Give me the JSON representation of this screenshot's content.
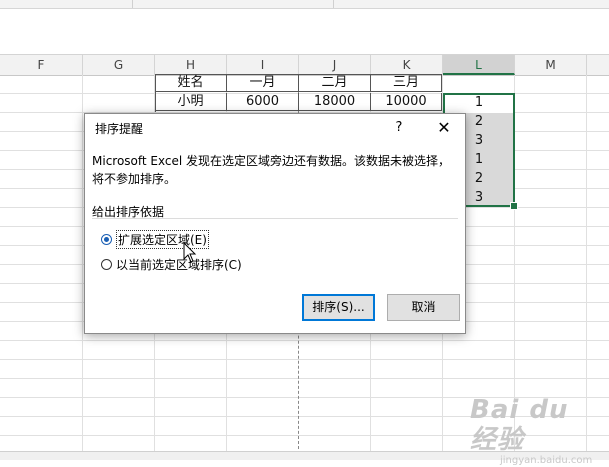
{
  "columns": [
    "F",
    "G",
    "H",
    "I",
    "J",
    "K",
    "L",
    "M"
  ],
  "table": {
    "header": [
      "姓名",
      "一月",
      "二月",
      "三月"
    ],
    "row1": [
      "小明",
      "6000",
      "18000",
      "10000"
    ]
  },
  "col_l_values": [
    "1",
    "2",
    "3",
    "1",
    "2",
    "3"
  ],
  "dialog": {
    "title": "排序提醒",
    "help": "?",
    "close": "✕",
    "message": "Microsoft Excel 发现在选定区域旁边还有数据。该数据未被选择，将不参加排序。",
    "group_label": "给出排序依据",
    "option_expand": "扩展选定区域(E)",
    "option_current": "以当前选定区域排序(C)",
    "expand_selected": true,
    "sort_button": "排序(S)...",
    "cancel_button": "取消"
  },
  "watermark": {
    "brand": "Bai du 经验",
    "url": "jingyan.baidu.com"
  },
  "colors": {
    "excel_green": "#217346",
    "focus_blue": "#0078d7",
    "selection_gray": "#d9d9d9"
  }
}
